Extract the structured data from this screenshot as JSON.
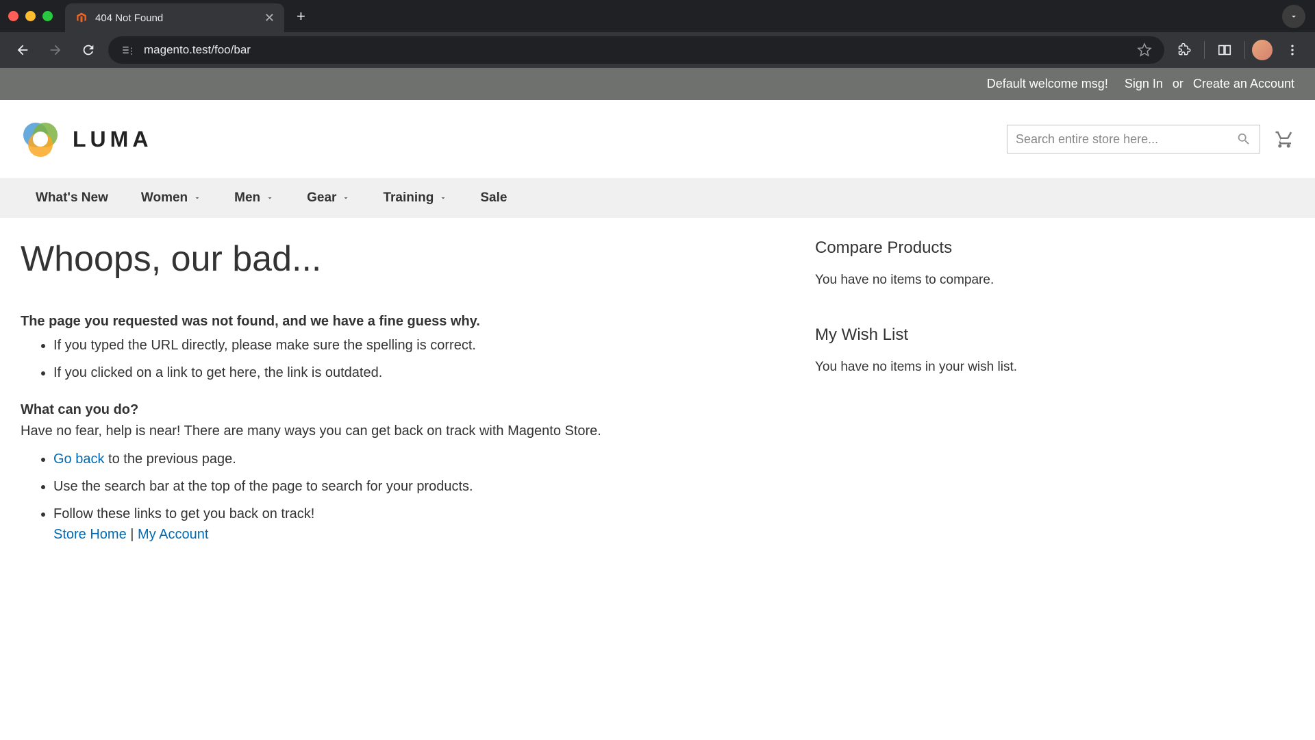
{
  "browser": {
    "tab_title": "404 Not Found",
    "url": "magento.test/foo/bar"
  },
  "panel": {
    "welcome": "Default welcome msg!",
    "signin": "Sign In",
    "or": "or",
    "create": "Create an Account"
  },
  "logo": {
    "text": "LUMA"
  },
  "search": {
    "placeholder": "Search entire store here..."
  },
  "nav": {
    "items": [
      {
        "label": "What's New",
        "dropdown": false
      },
      {
        "label": "Women",
        "dropdown": true
      },
      {
        "label": "Men",
        "dropdown": true
      },
      {
        "label": "Gear",
        "dropdown": true
      },
      {
        "label": "Training",
        "dropdown": true
      },
      {
        "label": "Sale",
        "dropdown": false
      }
    ]
  },
  "page": {
    "title": "Whoops, our bad...",
    "dt1": "The page you requested was not found, and we have a fine guess why.",
    "dd1_li1": "If you typed the URL directly, please make sure the spelling is correct.",
    "dd1_li2": "If you clicked on a link to get here, the link is outdated.",
    "dt2": "What can you do?",
    "dd2_p": "Have no fear, help is near! There are many ways you can get back on track with Magento Store.",
    "dd2_li1_link": "Go back",
    "dd2_li1_rest": " to the previous page.",
    "dd2_li2": "Use the search bar at the top of the page to search for your products.",
    "dd2_li3": "Follow these links to get you back on track!",
    "dd2_li3_link1": "Store Home",
    "dd2_li3_sep": " | ",
    "dd2_li3_link2": "My Account"
  },
  "sidebar": {
    "compare_title": "Compare Products",
    "compare_empty": "You have no items to compare.",
    "wishlist_title": "My Wish List",
    "wishlist_empty": "You have no items in your wish list."
  }
}
